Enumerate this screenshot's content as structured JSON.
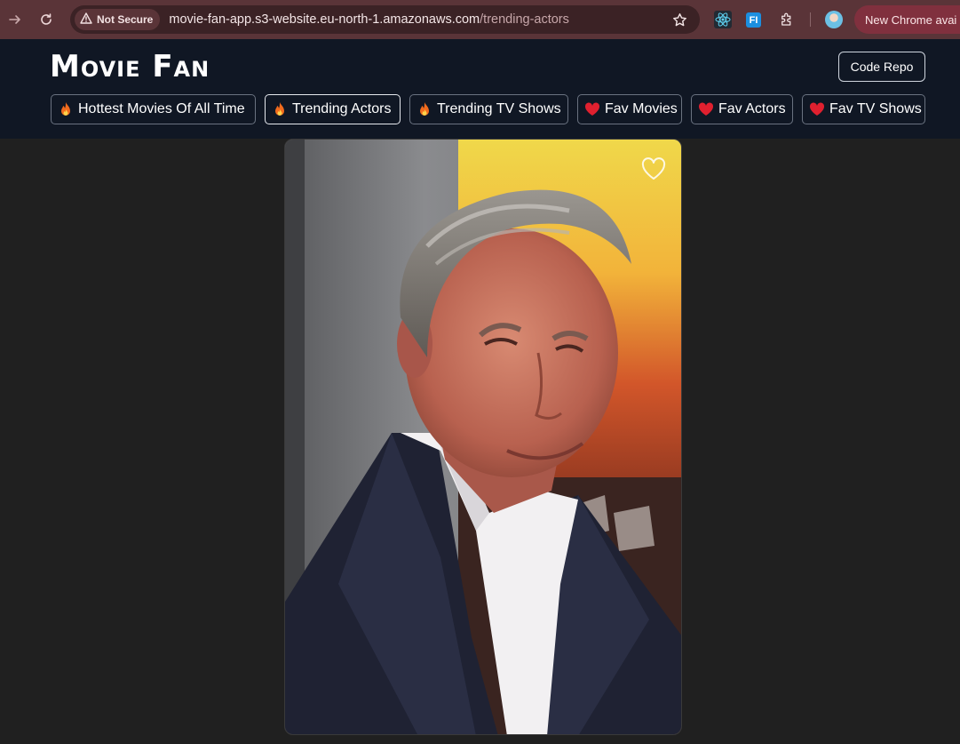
{
  "browser": {
    "security_label": "Not Secure",
    "url_host": "movie-fan-app.s3-website.eu-north-1.amazonaws.com",
    "url_path": "/trending-actors",
    "update_label": "New Chrome avai",
    "extension_fi_label": "FI",
    "icons": [
      "forward-icon",
      "reload-icon",
      "warning-icon",
      "star-icon",
      "react-icon",
      "puzzle-icon"
    ]
  },
  "app": {
    "title": "Movie Fan",
    "code_repo_label": "Code Repo"
  },
  "nav": {
    "tabs": [
      {
        "emoji": "fire",
        "label": "Hottest Movies Of All Time",
        "active": false
      },
      {
        "emoji": "fire",
        "label": "Trending Actors",
        "active": true
      },
      {
        "emoji": "fire",
        "label": "Trending TV Shows",
        "active": false
      },
      {
        "emoji": "heart",
        "label": "Fav Movies",
        "active": false
      },
      {
        "emoji": "heart",
        "label": "Fav Actors",
        "active": false
      },
      {
        "emoji": "heart",
        "label": "Fav TV Shows",
        "active": false
      }
    ]
  },
  "colors": {
    "header_bg": "#101724",
    "page_bg": "#202020",
    "browser_bg": "#5a3438",
    "fire": "#f26b1d",
    "heart": "#e0202f"
  }
}
